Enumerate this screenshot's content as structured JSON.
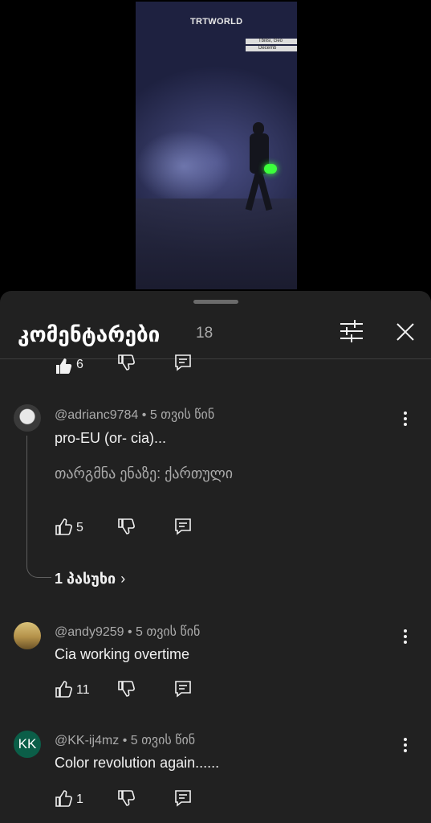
{
  "video": {
    "brand": "TRTWORLD",
    "tag_lines": [
      "Tbilisi, Geo",
      "Decemb"
    ]
  },
  "sheet": {
    "title": "კომენტარები",
    "count": "18",
    "icons": {
      "filter": "sliders-icon",
      "close": "close-icon"
    }
  },
  "prev_actions": {
    "likes": "6"
  },
  "comments": [
    {
      "author": "@adrianc9784",
      "time": "• 5 თვის წინ",
      "text": "pro-EU (or- cia)...",
      "translate": "თარგმნა ენაზე: ქართული",
      "likes": "5",
      "replies": "1 პასუხი"
    },
    {
      "author": "@andy9259",
      "time": "• 5 თვის წინ",
      "text": "Cia working overtime",
      "likes": "11"
    },
    {
      "author": "@KK-ij4mz",
      "time": "• 5 თვის წინ",
      "text": "Color revolution again......",
      "likes": "1",
      "avatar_initials": "KK",
      "avatar_color": "#0b5e48"
    }
  ]
}
